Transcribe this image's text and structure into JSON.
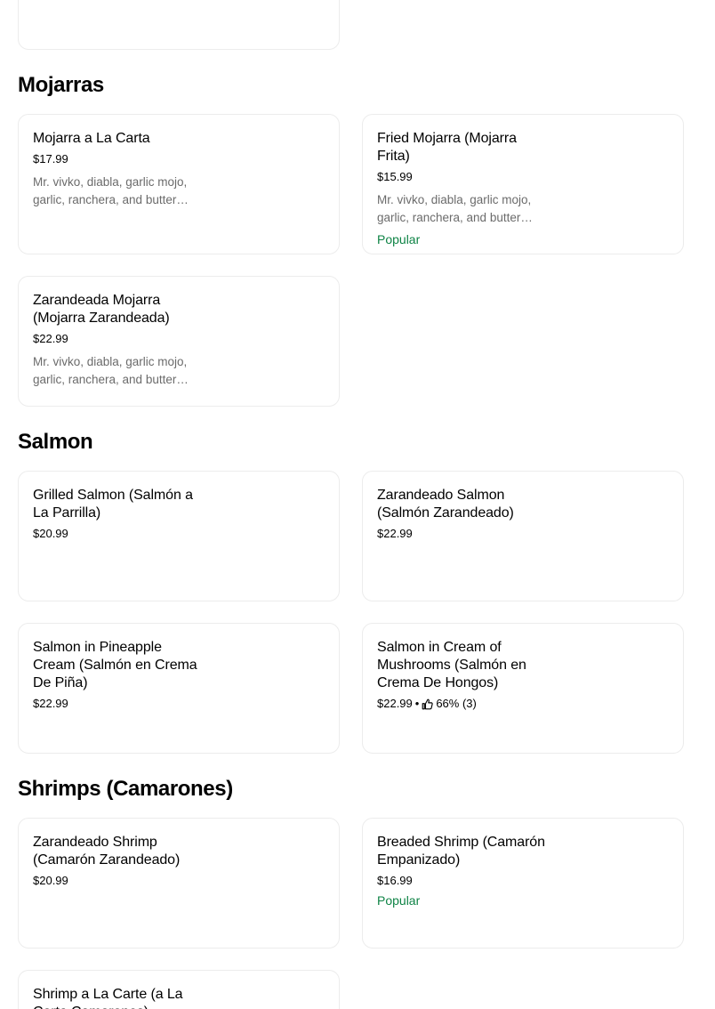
{
  "sections": [
    {
      "title": "Mojarras",
      "items": [
        {
          "name": "Mojarra a La Carta",
          "price": "$17.99",
          "description": "Mr. vivko, diabla, garlic mojo, garlic, ranchera, and butter…"
        },
        {
          "name": "Fried Mojarra (Mojarra Frita)",
          "price": "$15.99",
          "description": "Mr. vivko, diabla, garlic mojo, garlic, ranchera, and butter…",
          "badge": "Popular"
        },
        {
          "name": "Zarandeada Mojarra (Mojarra Zarandeada)",
          "price": "$22.99",
          "description": "Mr. vivko, diabla, garlic mojo, garlic, ranchera, and butter…"
        }
      ]
    },
    {
      "title": "Salmon",
      "items": [
        {
          "name": "Grilled Salmon (Salmón a La Parrilla)",
          "price": "$20.99"
        },
        {
          "name": "Zarandeado Salmon (Salmón Zarandeado)",
          "price": "$22.99"
        },
        {
          "name": "Salmon in Pineapple Cream (Salmón en Crema De Piña)",
          "price": "$22.99"
        },
        {
          "name": "Salmon in Cream of Mushrooms (Salmón en Crema De Hongos)",
          "price": "$22.99",
          "separator": "•",
          "rating": "66% (3)",
          "rating_icon": "thumbs-up-icon"
        }
      ]
    },
    {
      "title": "Shrimps (Camarones)",
      "items": [
        {
          "name": "Zarandeado Shrimp (Camarón Zarandeado)",
          "price": "$20.99"
        },
        {
          "name": "Breaded Shrimp (Camarón Empanizado)",
          "price": "$16.99",
          "badge": "Popular"
        },
        {
          "name": "Shrimp a La Carte (a La Carta Camarones)"
        }
      ]
    }
  ],
  "colors": {
    "popular": "#0e8345",
    "description": "#6b6b6b",
    "card_border": "#ececec"
  }
}
